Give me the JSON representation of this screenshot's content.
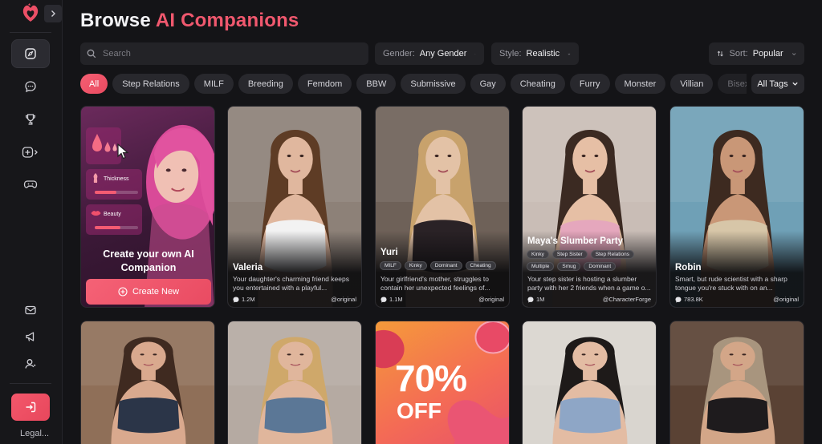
{
  "header": {
    "title_prefix": "Browse ",
    "title_accent": "AI Companions"
  },
  "search": {
    "placeholder": "Search",
    "value": ""
  },
  "filters": {
    "gender": {
      "label": "Gender:",
      "value": "Any Gender"
    },
    "style": {
      "label": "Style:",
      "value": "Realistic"
    },
    "sort": {
      "label": "Sort:",
      "value": "Popular"
    }
  },
  "tags": [
    "All",
    "Step Relations",
    "MILF",
    "Breeding",
    "Femdom",
    "BBW",
    "Submissive",
    "Gay",
    "Cheating",
    "Furry",
    "Monster",
    "Villian",
    "Bisexual"
  ],
  "all_tags_label": "All Tags",
  "sidebar": {
    "nav_icons": [
      "compass-icon",
      "chat-icon",
      "trophy-icon",
      "create-icon",
      "gamepad-icon"
    ],
    "bottom_icons": [
      "mail-icon",
      "megaphone-icon",
      "user-icon"
    ],
    "legal_label": "Legal..."
  },
  "create_card": {
    "title": "Create your own AI Companion",
    "button_label": "Create New",
    "sliders": [
      {
        "label": "Thickness",
        "level": 0.5
      },
      {
        "label": "Beauty",
        "level": 0.6
      }
    ]
  },
  "characters": [
    {
      "name": "Valeria",
      "tags": [],
      "description": "Your daughter's charming friend keeps you entertained with a playful...",
      "count": "1.2M",
      "author": "@original",
      "colors": {
        "bg": "#8d8178",
        "skin": "#e0b79e",
        "hair": "#5e3c25",
        "top": "#f2f2f2"
      }
    },
    {
      "name": "Yuri",
      "tags": [
        "MILF",
        "Kinky",
        "Dominant",
        "Cheating"
      ],
      "description": "Your girlfriend's mother, struggles to contain her unexpected feelings of...",
      "count": "1.1M",
      "author": "@original",
      "colors": {
        "bg": "#6e6158",
        "skin": "#e3c2a6",
        "hair": "#c8a26c",
        "top": "#2a2226"
      }
    },
    {
      "name": "Maya's Slumber Party",
      "tags": [
        "Kinky",
        "Step Sister",
        "Step Relations",
        "Multiple",
        "Smug",
        "Dominant"
      ],
      "description": "Your step sister is hosting a slumber party with her 2 friends when a game o...",
      "count": "1M",
      "author": "@CharacterForge",
      "colors": {
        "bg": "#c9bdb6",
        "skin": "#e6bfa5",
        "hair": "#3b2a22",
        "top": "#e5a7bd"
      }
    },
    {
      "name": "Robin",
      "tags": [],
      "description": "Smart, but rude scientist with a sharp tongue you're stuck with on an...",
      "count": "783.8K",
      "author": "@original",
      "colors": {
        "bg": "#6fa0b6",
        "skin": "#c99777",
        "hair": "#3d2a20",
        "top": "#d7c6a8"
      }
    }
  ],
  "row2": [
    {
      "colors": {
        "bg": "#8f6f58",
        "skin": "#d9a98e",
        "hair": "#3f2a20",
        "top": "#2b3548"
      }
    },
    {
      "colors": {
        "bg": "#b5aaa2",
        "skin": "#e0b69c",
        "hair": "#cfa86a",
        "top": "#5b7796"
      }
    },
    {
      "promo_text": "70%",
      "promo_sub": "OFF"
    },
    {
      "colors": {
        "bg": "#d9d5cf",
        "skin": "#e3bca3",
        "hair": "#1e1a19",
        "top": "#8ea6c6"
      }
    },
    {
      "colors": {
        "bg": "#5a4234",
        "skin": "#d3a688",
        "hair": "#a8957e",
        "top": "#1e1b1d"
      }
    }
  ]
}
